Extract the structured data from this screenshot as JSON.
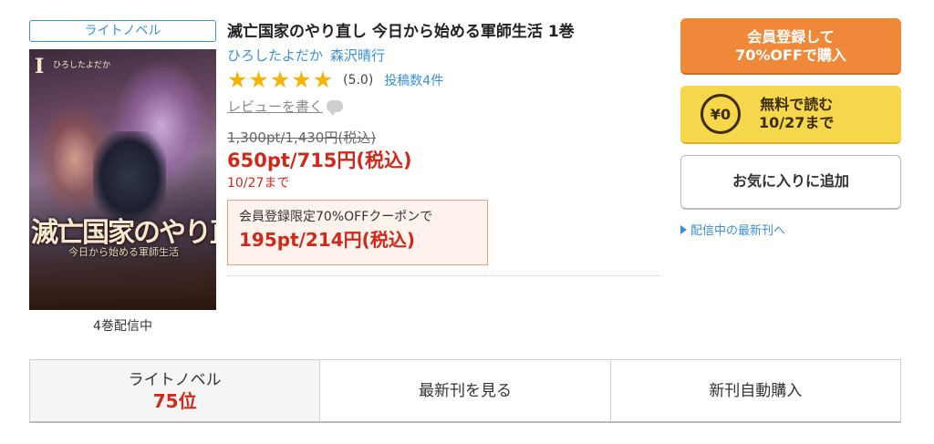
{
  "category": {
    "label": "ライトノベル"
  },
  "cover": {
    "volume_mark": "I",
    "author_small": "ひろしたよだか",
    "title_text": "滅亡国家のやり直し",
    "subtitle_text": "今日から始める軍師生活"
  },
  "volumes_note": "4巻配信中",
  "book": {
    "title": "滅亡国家のやり直し 今日から始める軍師生活 1巻",
    "authors": [
      "ひろしたよだか",
      "森沢晴行"
    ],
    "rating": {
      "stars": 5,
      "max": 5,
      "value_text": "(5.0)"
    },
    "review_count_text": "投稿数4件",
    "write_review": "レビューを書く"
  },
  "price": {
    "original": "1,300pt/1,430円(税込)",
    "sale": "650pt/715円(税込)",
    "sale_until": "10/27まで"
  },
  "coupon": {
    "label": "会員登録限定70%OFFクーポンで",
    "price": "195pt/214円(税込)"
  },
  "actions": {
    "register_line1": "会員登録して",
    "register_line2": "70%OFFで購入",
    "free_icon": "¥0",
    "free_line1": "無料で読む",
    "free_line2": "10/27まで",
    "favorite": "お気に入りに追加",
    "latest_link": "配信中の最新刊へ"
  },
  "bottom_bar": {
    "ranking_label": "ライトノベル",
    "ranking_value": "75位",
    "latest": "最新刊を見る",
    "auto_buy": "新刊自動購入"
  },
  "colors": {
    "link": "#3a8fd8",
    "price_red": "#d0291a",
    "register_orange": "#f0883a",
    "free_yellow": "#f6d64a",
    "star": "#f5b400"
  }
}
